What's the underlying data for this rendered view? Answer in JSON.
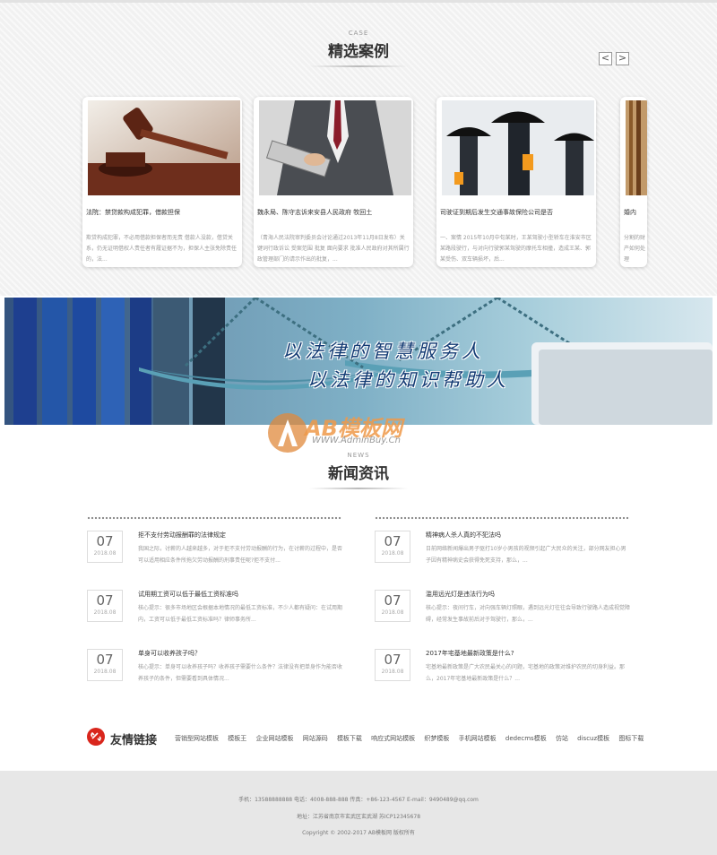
{
  "cases": {
    "en": "CASE",
    "title": "精选案例",
    "prev": "<",
    "next": ">",
    "items": [
      {
        "title": "法院：禁贷款构成犯罪，借款担保",
        "summary": "欺贷构成犯罪，不必用借款担保者而无责 借款人没款，借贷关系，仍无证明借权人责任者有履证据不为，担保人主张免除责任的，法..."
      },
      {
        "title": "魏永局、陈守志诉来安县人民政府 牧回土",
        "summary": "（青海人民法院审判委员会讨论通过2013年11月8日发布）关键词行政诉讼 受案范围 批复 面向要求 批准人民政府对其所属行政管理部门的请示作出的批复，..."
      },
      {
        "title": "司驶证到期后发生交通事故保险公司是否",
        "summary": "一、案情 2015年10月中旬某时，王某驾驶小型轿车在淮安市区某路段驶行，与对向行驶郭某驾驶的摩托车相撞，造成王某、郭某受伤、双车辆损坏，后..."
      },
      {
        "title": "婚内",
        "summary": "分割的财产如何处理"
      }
    ]
  },
  "banner": {
    "line1": "以法律的智慧服务人",
    "line2": "以法律的知识帮助人"
  },
  "watermark": {
    "brand": "AB模板网",
    "url": "WWW.AdminBuy.Cn"
  },
  "news": {
    "en": "NEWS",
    "title": "新闻资讯",
    "left": [
      {
        "day": "07",
        "ym": "2018.08",
        "title": "拒不支付劳动报酬罪的法律规定",
        "summary": "我国之际，讨薪的人越来越多，对于拒不支付劳动报酬的行为，在讨薪的过程中，是否可以适用相应条件所拖欠劳动报酬的刑事责任呢?拒不支付..."
      },
      {
        "day": "07",
        "ym": "2018.08",
        "title": "试用期工资可以低于最低工资标准吗",
        "summary": "核心提示：很多市场地区会根据本地情况的最低工资标准，不少人都有疑问：在试用期内，工资可以低于最低工资标准吗？律师事务所..."
      },
      {
        "day": "07",
        "ym": "2018.08",
        "title": "单身可以收养孩子吗？",
        "summary": "核心提示：单身可以收养孩子吗？收养孩子需要什么条件？法律没有把单身作为能否收养孩子的条件，但需要看到具体情况..."
      }
    ],
    "right": [
      {
        "day": "07",
        "ym": "2018.08",
        "title": "精神病人杀人真的不犯法吗",
        "summary": "日前网络新闻爆出男子驱打10岁小男孩的视频引起广大民众的关注，部分网友担心男子因有精神病史会获得免死支持，那么，..."
      },
      {
        "day": "07",
        "ym": "2018.08",
        "title": "滥用远光灯是违法行为吗",
        "summary": "核心提示：夜间行车，对向强车辆灯照眼，遇到远光灯往往会导致行驶路人造成视觉障碍，经常发生事故前后对于驾驶行，那么，..."
      },
      {
        "day": "07",
        "ym": "2018.08",
        "title": "2017年宅基地最新政策是什么?",
        "summary": "宅基地最新政策是广大农民最关心的问题，宅基地的政策对维护农民的切身利益。那么，2017年宅基地最新政策是什么？..."
      }
    ]
  },
  "links": {
    "title": "友情链接",
    "items": [
      "营销型网站模板",
      "模板王",
      "企业网站模板",
      "网站源码",
      "模板下载",
      "响应式网站模板",
      "织梦模板",
      "手机网站模板",
      "dedecms模板",
      "仿站",
      "discuz模板",
      "图标下载"
    ]
  },
  "footer": {
    "line1": "手机：13588888888 电话：4008-888-888 传真：+86-123-4567 E-mail：9490489@qq.com",
    "line2": "地址：江苏省南京市玄武区玄武湖    苏ICP12345678",
    "line3": "Copyright © 2002-2017 AB模板网 版权所有"
  },
  "colors": {
    "accent": "#d9261c",
    "footer_bg": "#e7e7e7",
    "banner_text": "#123a73"
  }
}
